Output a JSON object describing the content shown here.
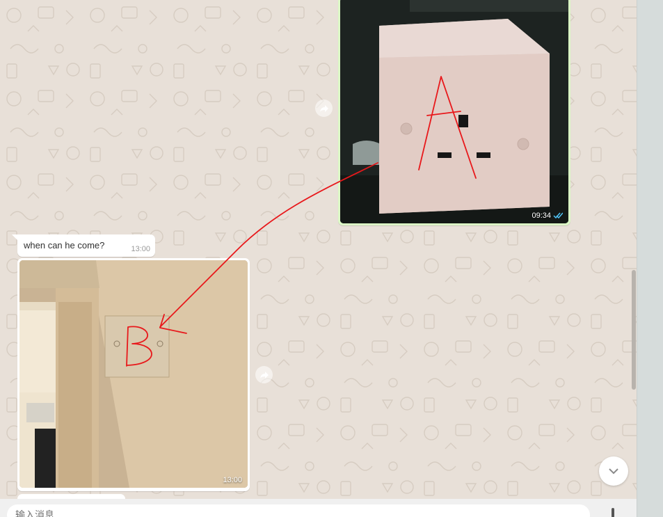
{
  "messages": {
    "outgoing_image": {
      "time": "09:34",
      "status_icon": "double-check-icon",
      "handwritten_label": "A"
    },
    "incoming_text": {
      "text": "when can he come?",
      "time": "13:00"
    },
    "incoming_image": {
      "time": "13:00",
      "handwritten_label": "B"
    }
  },
  "composer": {
    "placeholder": "输入消息"
  },
  "icons": {
    "forward": "forward-icon",
    "scroll_down": "chevron-down-icon",
    "mic": "mic-icon"
  },
  "colors": {
    "chat_background": "#e8e0d8",
    "outgoing_bubble": "#dcf8c6",
    "incoming_bubble": "#ffffff",
    "annotation_red": "#e8181b",
    "read_tick": "#4fc3f7"
  }
}
